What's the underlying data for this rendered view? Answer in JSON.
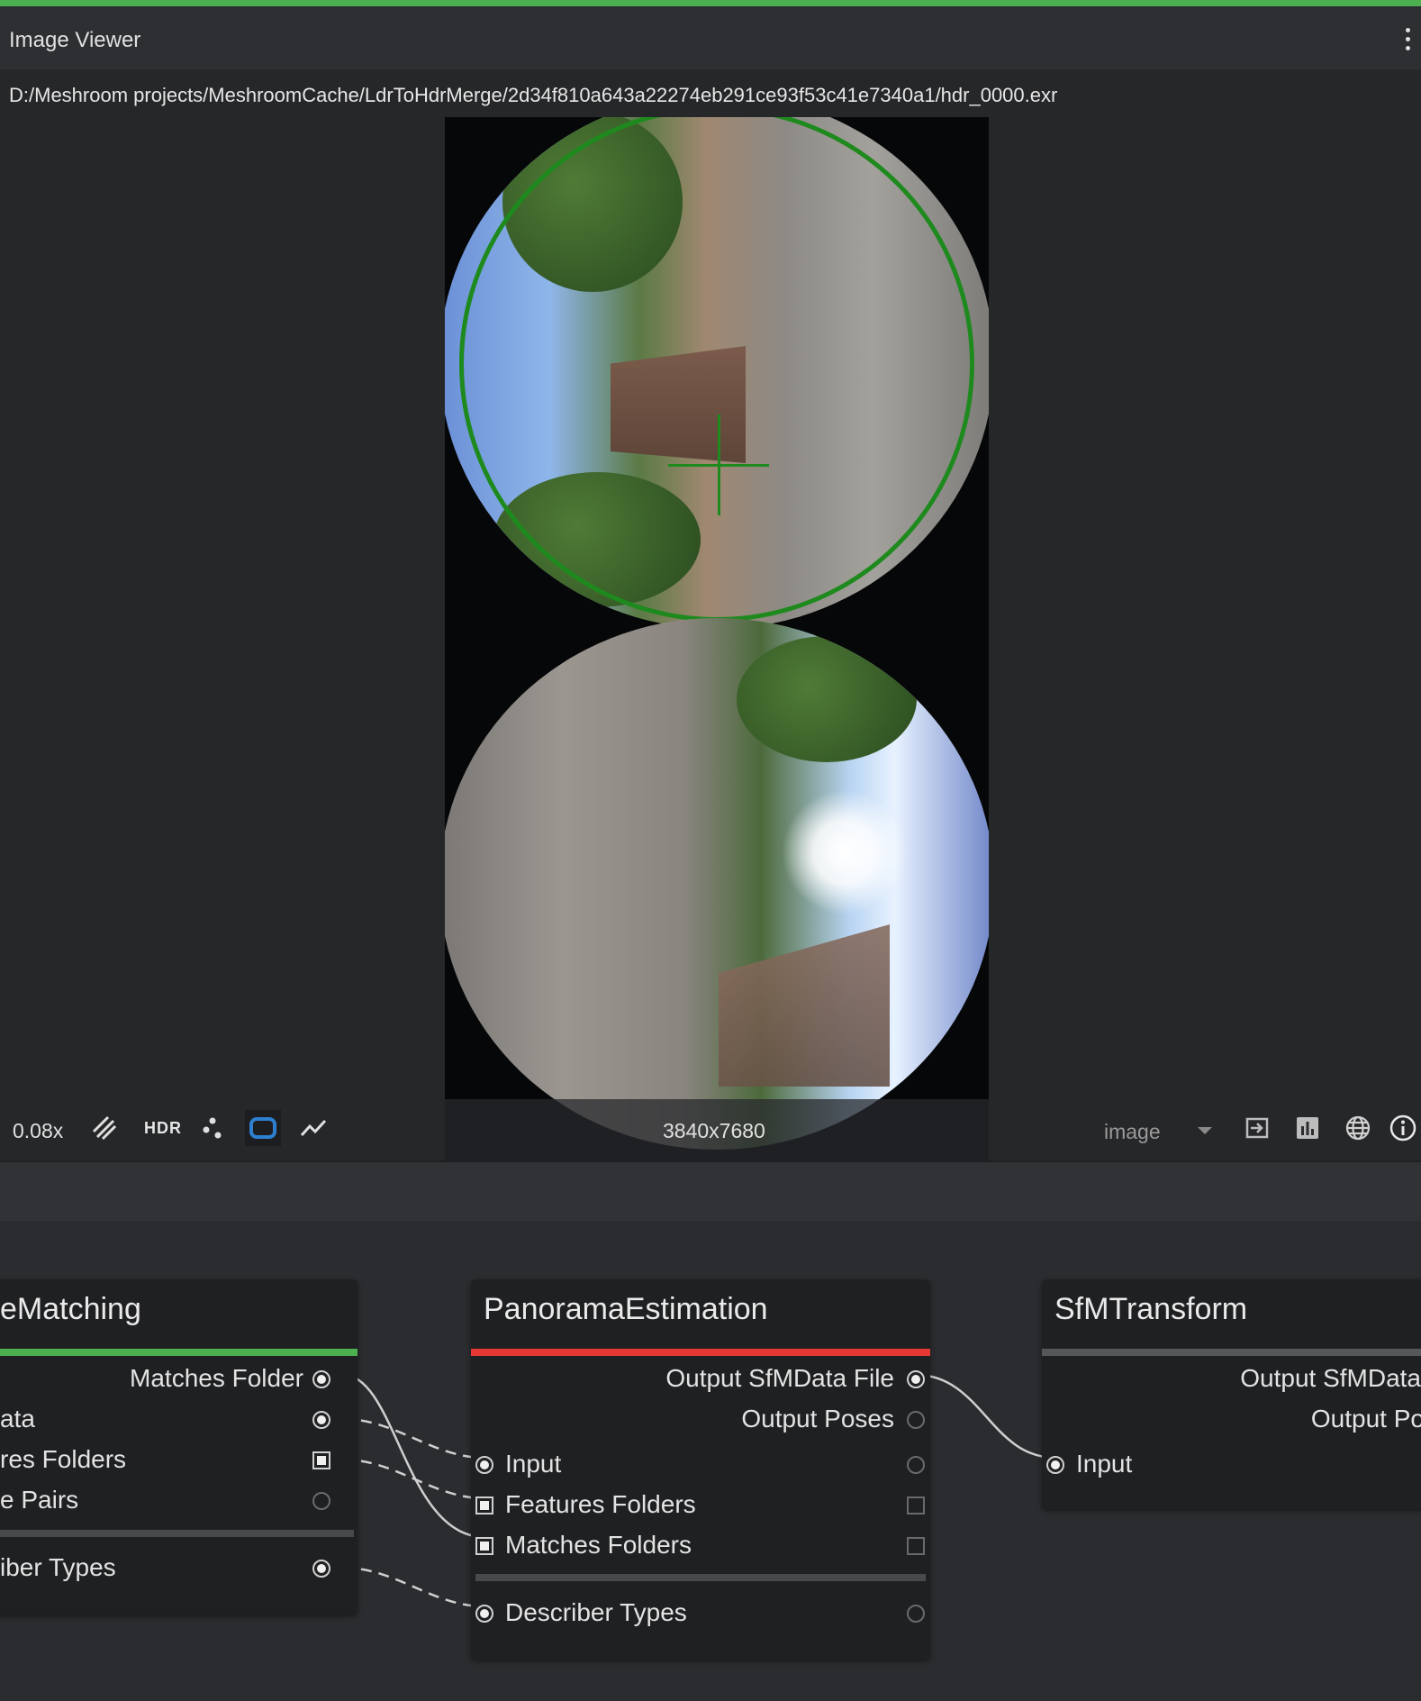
{
  "viewer": {
    "title": "Image Viewer",
    "file_path": "D:/Meshroom projects/MeshroomCache/LdrToHdrMerge/2d34f810a643a22274eb291ce93f53c41e7340a1/hdr_0000.exr",
    "zoom": "0.08x",
    "hdr_label": "HDR",
    "resolution": "3840x7680",
    "channel": "image"
  },
  "nodes": {
    "feature_matching": {
      "title": "eMatching",
      "outputs": [
        "Matches Folder"
      ],
      "inputs": [
        "ata",
        "res Folders",
        "e Pairs"
      ],
      "extra": [
        "iber Types"
      ],
      "status_color": "#4caf50"
    },
    "panorama_estimation": {
      "title": "PanoramaEstimation",
      "outputs": [
        "Output SfMData File",
        "Output Poses"
      ],
      "inputs": [
        "Input",
        "Features Folders",
        "Matches Folders"
      ],
      "extra": [
        "Describer Types"
      ],
      "status_color": "#e53935"
    },
    "sfm_transform": {
      "title": "SfMTransform",
      "outputs": [
        "Output SfMData",
        "Output Po"
      ],
      "inputs": [
        "Input"
      ],
      "status_color": "#55575b"
    }
  },
  "icons": [
    "kebab-menu-icon",
    "hatch-icon",
    "hdr-icon",
    "dots-icon",
    "rounded-rect-icon",
    "trend-line-icon",
    "caret-down-icon",
    "export-icon",
    "histogram-icon",
    "globe-icon",
    "info-icon"
  ],
  "colors": {
    "accent": "#4caf50",
    "error": "#e53935",
    "overlay_green": "#1e8a1e",
    "active_icon": "#2f7fd1"
  }
}
